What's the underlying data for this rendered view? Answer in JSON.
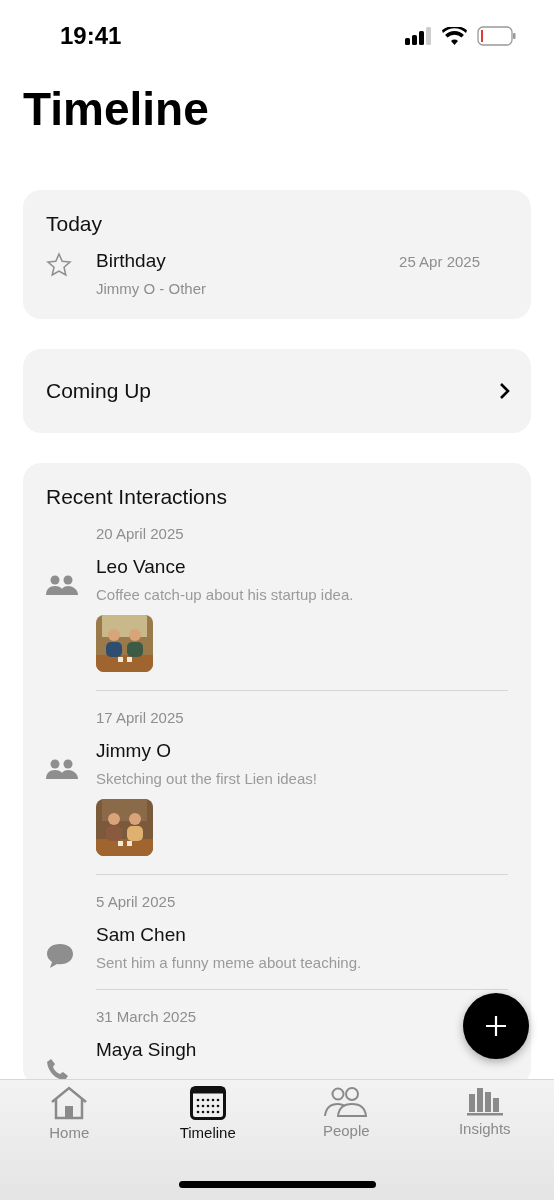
{
  "status_bar": {
    "time": "19:41"
  },
  "title": "Timeline",
  "today": {
    "heading": "Today",
    "events": [
      {
        "kind": "star",
        "title": "Birthday",
        "subtitle": "Jimmy O - Other",
        "date": "25 Apr 2025"
      }
    ]
  },
  "coming_up": {
    "label": "Coming Up"
  },
  "recent": {
    "heading": "Recent Interactions",
    "items": [
      {
        "kind": "group",
        "date": "20 April 2025",
        "name": "Leo Vance",
        "note": "Coffee catch-up about his startup idea."
      },
      {
        "kind": "group",
        "date": "17 April 2025",
        "name": "Jimmy O",
        "note": "Sketching out the first Lien ideas!"
      },
      {
        "kind": "message",
        "date": "5 April 2025",
        "name": "Sam Chen",
        "note": "Sent him a funny meme about teaching."
      },
      {
        "kind": "phone",
        "date": "31 March 2025",
        "name": "Maya Singh"
      }
    ]
  },
  "tabs": [
    {
      "kind": "home",
      "label": "Home",
      "selected": false
    },
    {
      "kind": "calendar",
      "label": "Timeline",
      "selected": true
    },
    {
      "kind": "people",
      "label": "People",
      "selected": false
    },
    {
      "kind": "chart",
      "label": "Insights",
      "selected": false
    }
  ]
}
